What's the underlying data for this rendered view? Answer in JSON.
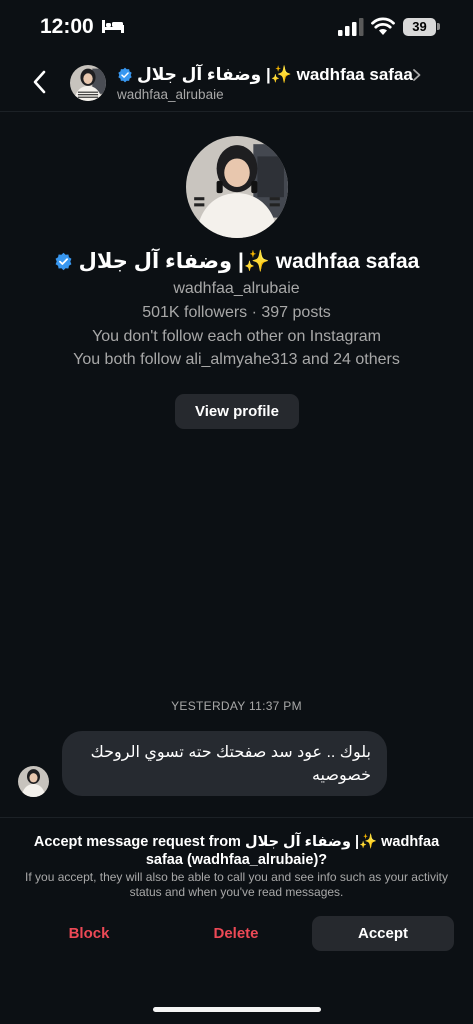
{
  "status_bar": {
    "time": "12:00",
    "battery": "39",
    "icons": [
      "bed-icon",
      "signal-icon",
      "wifi-icon",
      "battery-icon"
    ]
  },
  "header": {
    "name": "وضفاء آل جلال |✨ wadhfaa safaa",
    "username": "wadhfaa_alrubaie",
    "icons": [
      "back-icon",
      "verified-badge-icon",
      "chevron-right-icon"
    ]
  },
  "profile": {
    "name": "وضفاء آل جلال |✨ wadhfaa safaa",
    "username": "wadhfaa_alrubaie",
    "stats": "501K followers · 397 posts",
    "follow_status": "You don't follow each other on Instagram",
    "mutual": "You both follow ali_almyahe313 and 24 others",
    "view_profile_label": "View profile"
  },
  "conversation": {
    "timestamp": "YESTERDAY 11:37 PM",
    "messages": [
      {
        "text": "بلوك .. عود سد صفحتك حته تسوي الروحك خصوصيه"
      }
    ]
  },
  "request": {
    "title": "Accept message request from وضفاء آل جلال |✨ wadhfaa safaa (wadhfaa_alrubaie)?",
    "description": "If you accept, they will also be able to call you and see info such as your activity status and when you've read messages.",
    "block_label": "Block",
    "delete_label": "Delete",
    "accept_label": "Accept"
  },
  "colors": {
    "background": "#0c1014",
    "button_bg": "#26292e",
    "bubble_bg": "#262a30",
    "destructive": "#ed4956",
    "verified": "#3897f0",
    "secondary_text": "#a8a8a8"
  }
}
